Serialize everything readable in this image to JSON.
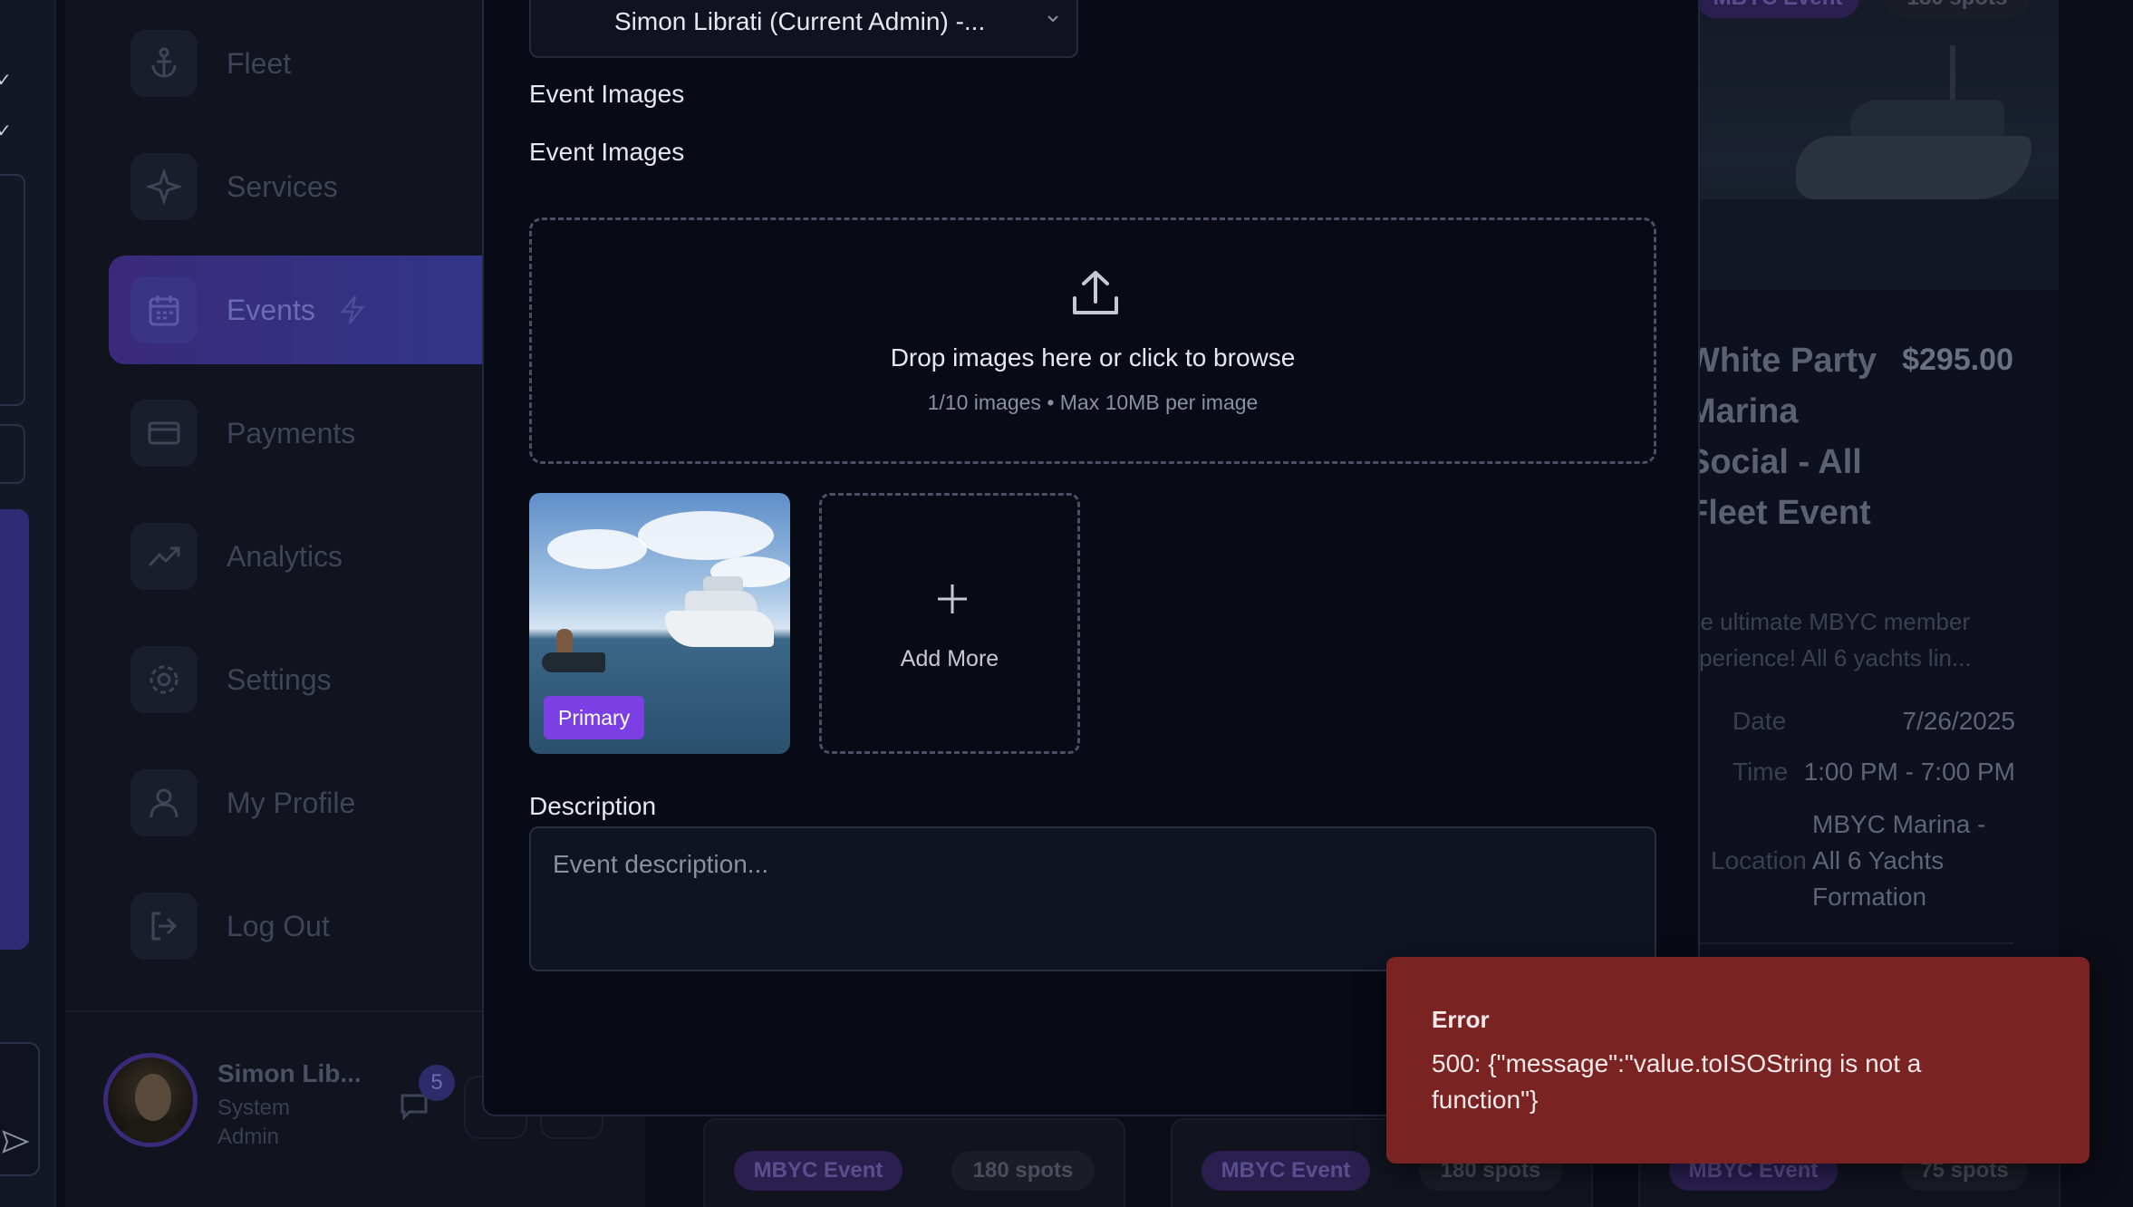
{
  "sidebar": {
    "items": [
      {
        "label": "Fleet",
        "icon": "anchor-icon"
      },
      {
        "label": "Services",
        "icon": "sparkle-icon"
      },
      {
        "label": "Events",
        "icon": "calendar-icon"
      },
      {
        "label": "Payments",
        "icon": "credit-card-icon"
      },
      {
        "label": "Analytics",
        "icon": "trending-up-icon"
      },
      {
        "label": "Settings",
        "icon": "gear-icon"
      },
      {
        "label": "My Profile",
        "icon": "user-icon"
      },
      {
        "label": "Log Out",
        "icon": "logout-icon"
      }
    ],
    "active_item": "Events",
    "user": {
      "name": "Simon Lib...",
      "role": "System Admin",
      "unread_count": "5"
    }
  },
  "modal": {
    "host_select_value": "Simon Librati (Current Admin) -...",
    "section_label": "Event Images",
    "field_label": "Event Images",
    "dropzone": {
      "title": "Drop images here or click to browse",
      "subtitle": "1/10 images • Max 10MB per image"
    },
    "primary_badge": "Primary",
    "add_more_label": "Add More",
    "description_label": "Description",
    "description_placeholder": "Event description..."
  },
  "background_card": {
    "badge": "MBYC Event",
    "spots": "180 spots",
    "title": "White Party Marina Social - All Fleet Event",
    "price": "$295.00",
    "description": "he ultimate MBYC member xperience! All 6 yachts lin...",
    "date_label": "Date",
    "date_value": "7/26/2025",
    "time_label": "Time",
    "time_value": "1:00 PM - 7:00 PM",
    "location_label": "Location",
    "location_value": "MBYC Marina - All 6 Yachts Formation"
  },
  "bottom_cards": [
    {
      "badge": "MBYC Event",
      "spots": "180 spots"
    },
    {
      "badge": "MBYC Event",
      "spots": "180 spots"
    },
    {
      "badge": "MBYC Event",
      "spots": "75 spots"
    }
  ],
  "toast": {
    "title": "Error",
    "message": "500: {\"message\":\"value.toISOString is not a function\"}"
  },
  "colors": {
    "accent_purple": "#7b3fe4",
    "error_red": "#7a2323",
    "modal_bg": "#080a15"
  }
}
